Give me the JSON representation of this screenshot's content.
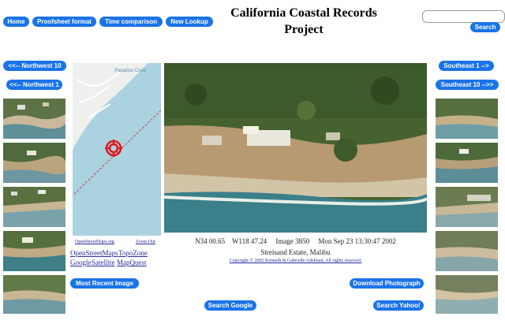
{
  "title_line1": "California Coastal Records",
  "title_line2": "Project",
  "nav": {
    "home": "Home",
    "proofsheet": "Proofsheet format",
    "time_comparison": "Time comparison",
    "new_lookup": "New Lookup"
  },
  "search": {
    "button": "Search",
    "value": ""
  },
  "left": {
    "nw10": "<<-- Northwest 10",
    "nw1": "<<-- Northwest 1"
  },
  "right": {
    "se1": "Southeast 1 -->",
    "se10": "Southeast 10 -->>"
  },
  "map": {
    "label": "Paradise Cove",
    "osm_link": "OpenStreetMaps.org",
    "zoom_out": "Zoom Out"
  },
  "map_links": {
    "osm": "OpenStreetMaps",
    "topozone": "TopoZone",
    "google": "Google",
    "satellite": "Satellite",
    "mapquest": "MapQuest"
  },
  "photo_info": {
    "lat": "N34 00.65",
    "lon": "W118 47.24",
    "image": "Image 3850",
    "date": "Mon Sep 23 13:30:47 2002",
    "caption": "Streisand Estate, Malibu",
    "copyright": "Copyright © 2002 Kenneth & Gabrielle Adelman, All rights reserved."
  },
  "buttons": {
    "most_recent": "Most Recent Image",
    "download": "Download Photograph",
    "search_google": "Search Google",
    "search_yahoo": "Search Yahoo!"
  },
  "colors": {
    "button_blue": "#1a73e8",
    "map_land": "#eef0ee",
    "map_water": "#aad3df",
    "marker_red": "#e0151a"
  }
}
